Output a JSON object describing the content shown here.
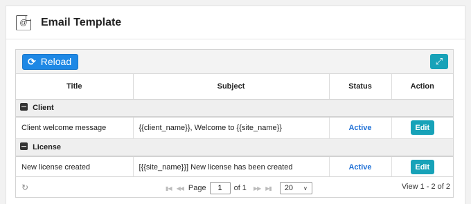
{
  "page": {
    "title": "Email Template",
    "icon": "email-document-icon"
  },
  "toolbar": {
    "reload_label": "Reload",
    "reload_icon": "refresh-icon",
    "expand_icon": "expand-icon",
    "accent_blue": "#1e88e5",
    "accent_teal": "#17a2b8"
  },
  "table": {
    "columns": [
      "Title",
      "Subject",
      "Status",
      "Action"
    ],
    "groups": [
      {
        "name": "Client",
        "rows": [
          {
            "title": "Client welcome message",
            "subject": "{{client_name}}, Welcome to {{site_name}}",
            "status": "Active",
            "action": "Edit"
          }
        ]
      },
      {
        "name": "License",
        "rows": [
          {
            "title": "New license created",
            "subject": "[{{site_name}}] New license has been created",
            "status": "Active",
            "action": "Edit"
          }
        ]
      }
    ]
  },
  "pager": {
    "page_label": "Page",
    "page_value": "1",
    "of_label": "of 1",
    "page_size": "20",
    "view_text": "View 1 - 2 of 2"
  }
}
